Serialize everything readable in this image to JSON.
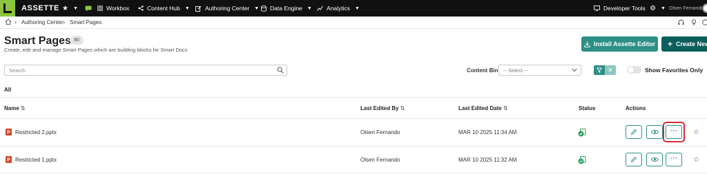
{
  "topnav": {
    "brand": "ASSETTE",
    "workbox": "Workbox",
    "content_hub": "Content Hub",
    "authoring_center": "Authoring Center",
    "data_engine": "Data Engine",
    "analytics": "Analytics",
    "developer_tools": "Developer Tools",
    "user_name": "Olsen Fernando"
  },
  "breadcrumb": {
    "items": [
      "Authoring Center",
      "Smart Pages"
    ]
  },
  "header": {
    "title": "Smart Pages",
    "count": "80",
    "subtitle": "Create, edit and manage Smart Pages which are building blocks for Smart Docs",
    "install_button": "Install Assette Editor",
    "create_button": "Create New"
  },
  "toolbar": {
    "search_placeholder": "Search",
    "content_bin_label": "Content Bin",
    "content_bin_value": "-- Select --",
    "show_favorites_label": "Show Favorites Only",
    "show_favorites_on": false
  },
  "tabs": {
    "active": "All"
  },
  "table": {
    "columns": {
      "name": "Name",
      "last_edited_by": "Last Edited By",
      "last_edited_date": "Last Edited Date",
      "status": "Status",
      "actions": "Actions"
    },
    "rows": [
      {
        "name": "Restricted 2.pptx",
        "last_edited_by": "Olsen Fernando",
        "last_edited_date": "MAR 10 2025 11:34 AM"
      },
      {
        "name": "Restricted 1.pptx",
        "last_edited_by": "Olsen Fernando",
        "last_edited_date": "MAR 10 2025 11:32 AM"
      }
    ]
  },
  "icons": {
    "nav": [
      "star-icon",
      "chat-icon",
      "grid-icon",
      "share-icon",
      "edit-icon",
      "database-icon",
      "chart-icon",
      "monitor-icon",
      "gear-icon"
    ],
    "row": [
      "pptx-file-icon",
      "status-published-icon",
      "edit-icon",
      "eye-icon",
      "more-icon",
      "star-outline-icon"
    ]
  },
  "colors": {
    "accent_teal": "#2d8f85",
    "dark_teal": "#0b5e5e",
    "brand_green": "#8cc63f",
    "highlight_red": "#d9282f",
    "nav_background": "#111111"
  }
}
